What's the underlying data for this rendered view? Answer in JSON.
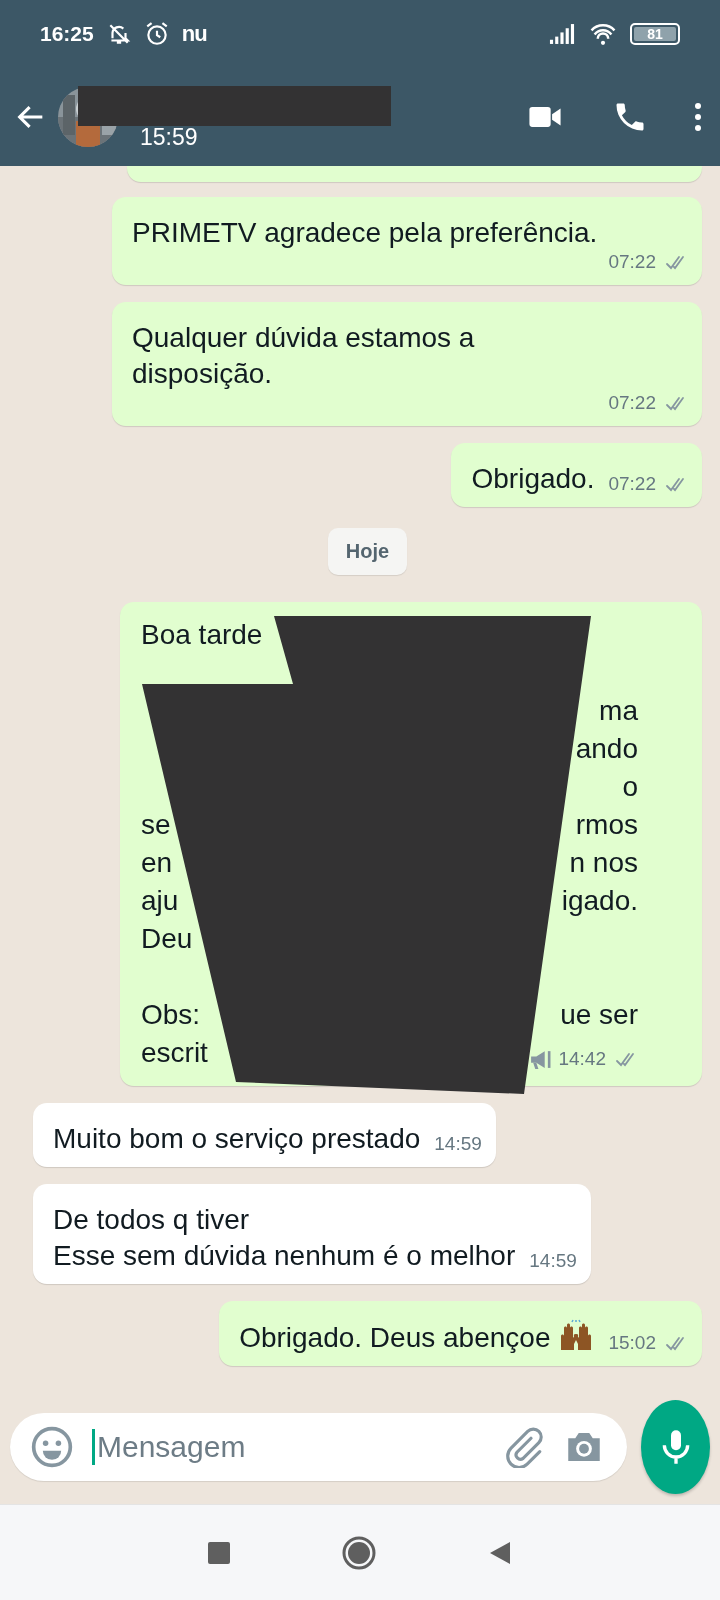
{
  "status_bar": {
    "time": "16:25",
    "notification_logo": "nu",
    "battery": "81"
  },
  "header": {
    "subtitle": "15:59"
  },
  "messages": [
    {
      "kind": "partial",
      "outgoing": true
    },
    {
      "kind": "text",
      "outgoing": true,
      "text": "PRIMETV agradece pela preferência.",
      "time": "07:22",
      "read": false
    },
    {
      "kind": "text",
      "outgoing": true,
      "text": "Qualquer dúvida estamos a disposição.",
      "time": "07:22",
      "read": false
    },
    {
      "kind": "text",
      "outgoing": true,
      "text": "Obrigado.",
      "time": "07:22",
      "read": false
    },
    {
      "kind": "date",
      "text": "Hoje"
    },
    {
      "kind": "redacted",
      "outgoing": true,
      "broadcast": true,
      "time": "14:42",
      "read": false,
      "lines": [
        {
          "kind": "text",
          "left": "Boa tarde"
        },
        {
          "kind": "blank"
        },
        {
          "kind": "text",
          "right": "ma"
        },
        {
          "kind": "text",
          "right": "ando"
        },
        {
          "kind": "text",
          "right": "o"
        },
        {
          "kind": "text",
          "left": "se",
          "right": "rmos"
        },
        {
          "kind": "text",
          "left": "en",
          "right": "n nos"
        },
        {
          "kind": "text",
          "left": "aju",
          "right": "igado."
        },
        {
          "kind": "text",
          "left": "Deu"
        },
        {
          "kind": "blank"
        },
        {
          "kind": "text",
          "left": "Obs:",
          "right": "ue ser"
        },
        {
          "kind": "text",
          "left": "escrit"
        }
      ]
    },
    {
      "kind": "text",
      "outgoing": false,
      "text": "Muito bom o serviço prestado",
      "time": "14:59"
    },
    {
      "kind": "text",
      "outgoing": false,
      "text": "De todos q tiver\nEsse sem dúvida nenhum é o melhor",
      "time": "14:59"
    },
    {
      "kind": "emoji_text",
      "outgoing": true,
      "text": "Obrigado. Deus abençoe",
      "time": "15:02",
      "read": false
    }
  ],
  "composer": {
    "placeholder": "Mensagem"
  }
}
